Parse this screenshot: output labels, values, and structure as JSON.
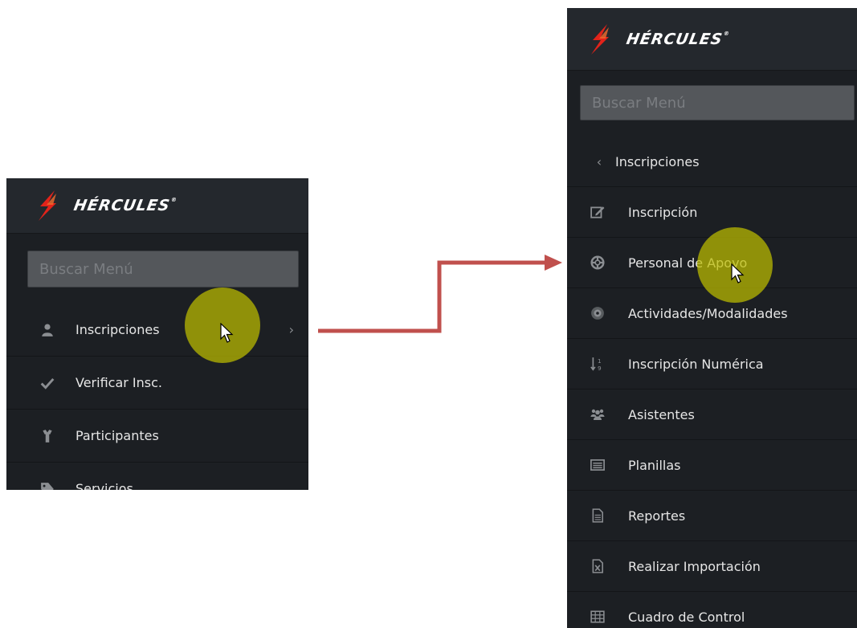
{
  "brand": {
    "name": "HÉRCULES",
    "trademark": "®",
    "accent": "#e2231a"
  },
  "left_panel": {
    "search_placeholder": "Buscar Menú",
    "items": [
      {
        "label": "Inscripciones",
        "icon": "user-icon",
        "has_submenu": true
      },
      {
        "label": "Verificar Insc.",
        "icon": "check-icon"
      },
      {
        "label": "Participantes",
        "icon": "person-icon"
      },
      {
        "label": "Servicios",
        "icon": "tag-icon"
      }
    ]
  },
  "right_panel": {
    "search_placeholder": "Buscar Menú",
    "back_label": "Inscripciones",
    "items": [
      {
        "label": "Inscripción",
        "icon": "edit-icon"
      },
      {
        "label": "Personal de Apoyo",
        "icon": "lifebuoy-icon"
      },
      {
        "label": "Actividades/Modalidades",
        "icon": "target-icon"
      },
      {
        "label": "Inscripción Numérica",
        "icon": "sort-numeric-icon"
      },
      {
        "label": "Asistentes",
        "icon": "users-icon"
      },
      {
        "label": "Planillas",
        "icon": "list-icon"
      },
      {
        "label": "Reportes",
        "icon": "file-text-icon"
      },
      {
        "label": "Realizar Importación",
        "icon": "file-excel-icon"
      },
      {
        "label": "Cuadro de Control",
        "icon": "table-icon"
      }
    ]
  },
  "colors": {
    "sidebar_bg": "#1c1f23",
    "header_bg": "#24282d",
    "click_marker": "#bebe00",
    "arrow": "#c0504d"
  }
}
